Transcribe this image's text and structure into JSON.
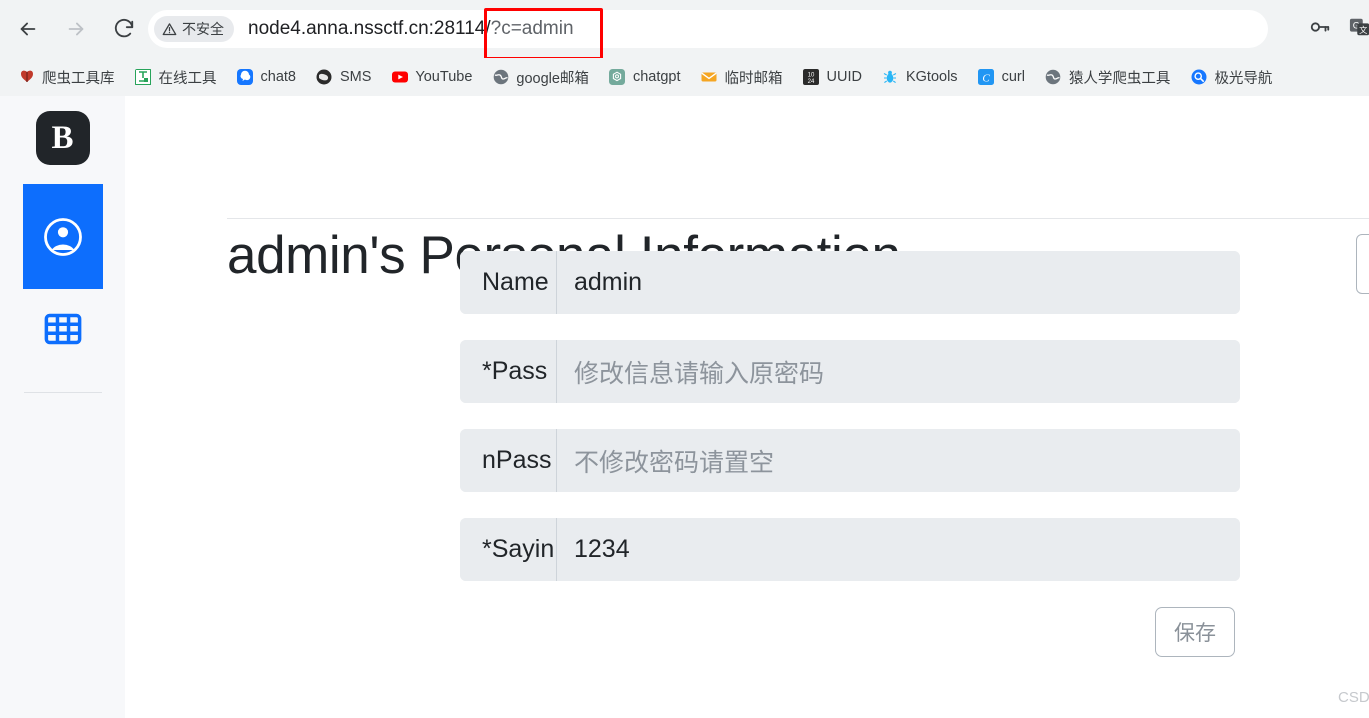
{
  "browser": {
    "nav": {
      "back_label": "Back",
      "forward_label": "Forward",
      "reload_label": "Reload"
    },
    "omnibox": {
      "security_label": "不安全",
      "security_icon": "warning-triangle-icon",
      "url_host": "node4.anna.nssctf.cn:28114/",
      "url_query": "?c=admin",
      "full_url": "node4.anna.nssctf.cn:28114/?c=admin",
      "key_icon": "key-icon",
      "translate_icon": "translate-icon"
    },
    "bookmarks": [
      {
        "label": "爬虫工具库",
        "icon": "butterfly-icon",
        "color": "#c0392b"
      },
      {
        "label": "在线工具",
        "icon": "tool-grid-icon",
        "color": "#27a35a"
      },
      {
        "label": "chat8",
        "icon": "chat-bubble-icon",
        "color": "#1677ff"
      },
      {
        "label": "SMS",
        "icon": "sms-icon",
        "color": "#2b2b2b"
      },
      {
        "label": "YouTube",
        "icon": "youtube-icon",
        "color": "#ff0000"
      },
      {
        "label": "google邮箱",
        "icon": "globe-icon",
        "color": "#6c757d"
      },
      {
        "label": "chatgpt",
        "icon": "openai-icon",
        "color": "#74aa9c"
      },
      {
        "label": "临时邮箱",
        "icon": "envelope-icon",
        "color": "#f5a623"
      },
      {
        "label": "UUID",
        "icon": "1024-icon",
        "color": "#2b2b2b"
      },
      {
        "label": "KGtools",
        "icon": "bug-icon",
        "color": "#29b6f6"
      },
      {
        "label": "curl",
        "icon": "curl-c-icon",
        "color": "#2196f3"
      },
      {
        "label": "猿人学爬虫工具",
        "icon": "globe-icon",
        "color": "#6c757d"
      },
      {
        "label": "极光导航",
        "icon": "search-circle-icon",
        "color": "#1677ff"
      }
    ]
  },
  "sidebar": {
    "brand_letter": "B",
    "items": [
      {
        "name": "person-icon",
        "label": "Personal Information",
        "active": true
      },
      {
        "name": "table-icon",
        "label": "Table",
        "active": false
      }
    ]
  },
  "main": {
    "title": "admin's Personal Information",
    "fields": [
      {
        "label": "Name",
        "value": "admin",
        "placeholder": "",
        "is_placeholder": false
      },
      {
        "label": "*Pass",
        "value": "修改信息请输入原密码",
        "placeholder": "修改信息请输入原密码",
        "is_placeholder": true
      },
      {
        "label": "nPass",
        "value": "不修改密码请置空",
        "placeholder": "不修改密码请置空",
        "is_placeholder": true
      },
      {
        "label": "*Sayin",
        "value": "1234",
        "placeholder": "",
        "is_placeholder": false
      }
    ],
    "save_label": "保存"
  },
  "watermark": "CSDN @晓雨风声",
  "colors": {
    "accent": "#0d6efd",
    "chrome_bg": "#f1f3f4",
    "sidebar_bg": "#f7f8fa",
    "field_bg": "#e9ecef",
    "annotation_red": "#ff0000"
  }
}
